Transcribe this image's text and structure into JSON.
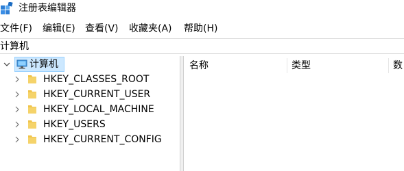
{
  "window": {
    "title": "注册表编辑器",
    "icon": "registry-editor-icon"
  },
  "menu": {
    "items": [
      {
        "label": "文件(F)"
      },
      {
        "label": "编辑(E)"
      },
      {
        "label": "查看(V)"
      },
      {
        "label": "收藏夹(A)"
      },
      {
        "label": "帮助(H)"
      }
    ]
  },
  "address": {
    "path": "计算机"
  },
  "tree": {
    "root": {
      "label": "计算机",
      "icon": "computer-icon",
      "expanded": true,
      "selected": true
    },
    "items": [
      {
        "label": "HKEY_CLASSES_ROOT",
        "icon": "folder-icon"
      },
      {
        "label": "HKEY_CURRENT_USER",
        "icon": "folder-icon"
      },
      {
        "label": "HKEY_LOCAL_MACHINE",
        "icon": "folder-icon"
      },
      {
        "label": "HKEY_USERS",
        "icon": "folder-icon"
      },
      {
        "label": "HKEY_CURRENT_CONFIG",
        "icon": "folder-icon"
      }
    ]
  },
  "list": {
    "columns": [
      {
        "label": "名称"
      },
      {
        "label": "类型"
      },
      {
        "label": "数"
      }
    ]
  },
  "colors": {
    "selection_fill": "#cce8ff",
    "selection_border": "#99d1ff",
    "folder": "#f0c44a"
  }
}
